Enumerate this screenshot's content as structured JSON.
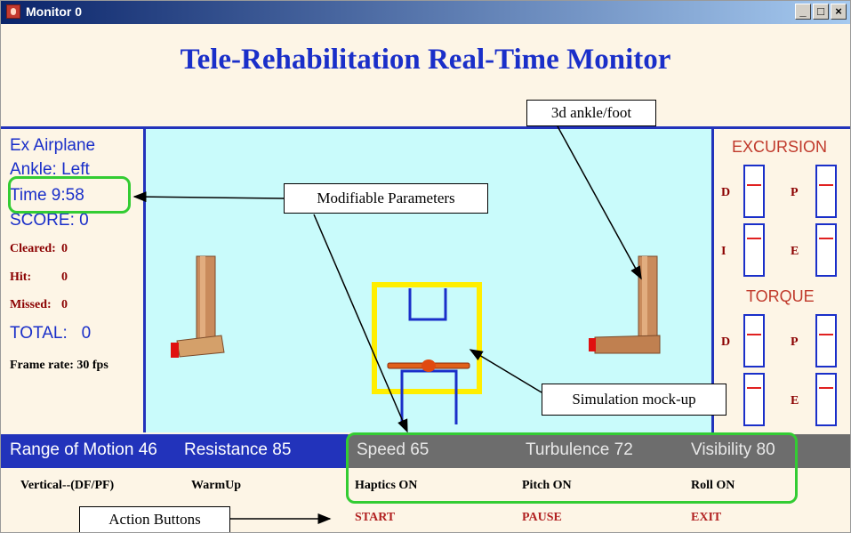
{
  "window": {
    "title": "Monitor 0",
    "buttons": {
      "minimize": "_",
      "maximize": "□",
      "close": "×"
    }
  },
  "heading": "Tele-Rehabilitation Real-Time Monitor",
  "left_panel": {
    "exercise": "Ex Airplane",
    "ankle": "Ankle: Left",
    "time": "Time 9:58",
    "score": "SCORE: 0",
    "cleared_label": "Cleared:",
    "cleared_value": "0",
    "hit_label": "Hit:",
    "hit_value": "0",
    "missed_label": "Missed:",
    "missed_value": "0",
    "total": "TOTAL:   0",
    "frame_rate": "Frame rate: 30 fps"
  },
  "right_panel": {
    "excursion_title": "EXCURSION",
    "torque_title": "TORQUE",
    "excursion_labels": [
      "D",
      "P",
      "I",
      "E"
    ],
    "torque_labels": [
      "D",
      "P",
      "",
      "E"
    ]
  },
  "params": {
    "range_of_motion": "Range of Motion  46",
    "resistance": "Resistance  85",
    "speed": "Speed  65",
    "turbulence": "Turbulence  72",
    "visibility": "Visibility  80"
  },
  "buttons_row1": {
    "vertical": "Vertical--(DF/PF)",
    "warmup": "WarmUp",
    "haptics": "Haptics  ON",
    "pitch": "Pitch  ON",
    "roll": "Roll  ON"
  },
  "buttons_row2": {
    "start": "START",
    "pause": "PAUSE",
    "exit": "EXIT"
  },
  "callouts": {
    "ankle_foot": "3d ankle/foot",
    "modifiable": "Modifiable Parameters",
    "simulation": "Simulation mock-up",
    "action_buttons": "Action Buttons"
  },
  "colors": {
    "title_blue": "#1a2fc9",
    "scene_bg": "#c9fbfb",
    "highlight_green": "#33cc33",
    "target_yellow": "#ffee00",
    "leg_brown": "#c98b5c",
    "toe_red": "#e01010"
  }
}
